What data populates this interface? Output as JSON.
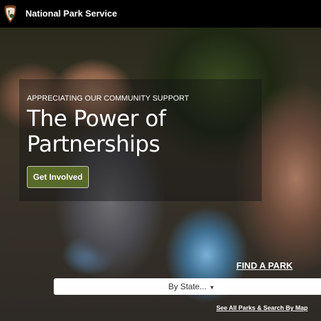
{
  "header": {
    "title": "National Park Service",
    "logo": "nps-arrowhead-logo"
  },
  "hero": {
    "kicker": "APPRECIATING OUR COMMUNITY SUPPORT",
    "headline_line1": "The Power of",
    "headline_line2": "Partnerships",
    "cta_label": "Get Involved",
    "cta_color": "#586a2a"
  },
  "find_park": {
    "title": "FIND A PARK",
    "select_value": "By State...",
    "map_link": "See All Parks & Search By Map"
  }
}
